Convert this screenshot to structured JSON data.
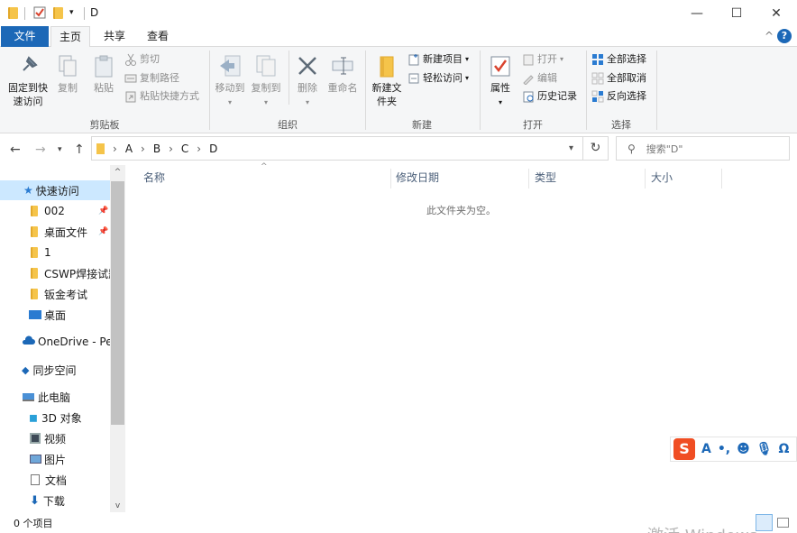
{
  "window": {
    "title": "D",
    "minimize": "—",
    "maximize": "☐",
    "close": "✕"
  },
  "tabs": {
    "file": "文件",
    "home": "主页",
    "share": "共享",
    "view": "查看",
    "collapse": "^",
    "help": "?"
  },
  "ribbon": {
    "clipboard": {
      "label": "剪贴板",
      "pin_quick": "固定到快速访问",
      "copy": "复制",
      "paste": "粘贴",
      "cut": "剪切",
      "copy_path": "复制路径",
      "paste_shortcut": "粘贴快捷方式"
    },
    "organize": {
      "label": "组织",
      "move_to": "移动到",
      "copy_to": "复制到",
      "delete": "删除",
      "rename": "重命名"
    },
    "new": {
      "label": "新建",
      "new_folder": "新建文件夹",
      "new_item": "新建项目",
      "easy_access": "轻松访问"
    },
    "open": {
      "label": "打开",
      "properties": "属性",
      "open": "打开",
      "edit": "编辑",
      "history": "历史记录"
    },
    "select": {
      "label": "选择",
      "select_all": "全部选择",
      "select_none": "全部取消",
      "invert": "反向选择"
    }
  },
  "address": {
    "path": [
      "A",
      "B",
      "C",
      "D"
    ],
    "search_placeholder": "搜索\"D\""
  },
  "navpane": {
    "quick_access": "快速访问",
    "items": [
      {
        "label": "002",
        "pinned": true
      },
      {
        "label": "桌面文件",
        "pinned": true
      },
      {
        "label": "1",
        "pinned": false
      },
      {
        "label": "CSWP焊接试题",
        "pinned": false
      },
      {
        "label": "钣金考试",
        "pinned": false
      }
    ],
    "desktop": "桌面",
    "onedrive": "OneDrive - Per",
    "sync": "同步空间",
    "this_pc": "此电脑",
    "pc_items": [
      "3D 对象",
      "视频",
      "图片",
      "文档",
      "下载"
    ]
  },
  "content": {
    "columns": [
      "名称",
      "修改日期",
      "类型",
      "大小"
    ],
    "empty_message": "此文件夹为空。"
  },
  "status": {
    "item_count": "0 个项目"
  },
  "watermark": "激活 Windows",
  "colors": {
    "accent": "#1c68b7",
    "selection": "#cce8ff",
    "folder": "#f5c44a"
  }
}
